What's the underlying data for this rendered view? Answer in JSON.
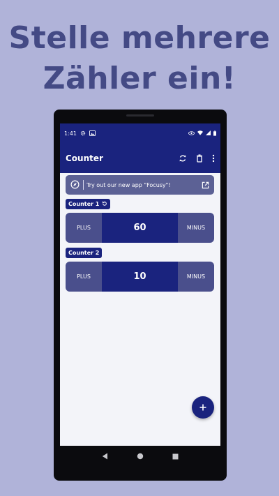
{
  "headline": {
    "line1": "Stelle mehrere",
    "line2": "Zähler ein!"
  },
  "status_bar": {
    "time": "1:41",
    "icons": [
      "gear-icon",
      "photo-icon",
      "eye-icon",
      "wifi-icon",
      "signal-icon",
      "battery-icon"
    ]
  },
  "app_bar": {
    "title": "Counter",
    "actions": [
      "refresh-icon",
      "delete-icon",
      "more-vert-icon"
    ]
  },
  "banner": {
    "text": "Try out our new app \"Focusy\"!",
    "icons": [
      "compass-icon",
      "open-external-icon"
    ]
  },
  "counters": [
    {
      "name": "Counter 1",
      "value": "60",
      "plus_label": "PLUS",
      "minus_label": "MINUS",
      "has_reset_icon": true
    },
    {
      "name": "Counter 2",
      "value": "10",
      "plus_label": "PLUS",
      "minus_label": "MINUS",
      "has_reset_icon": false
    }
  ],
  "fab": {
    "icon": "plus-icon"
  },
  "nav_bar": {
    "icons": [
      "back-icon",
      "home-icon",
      "recents-icon"
    ]
  },
  "colors": {
    "background": "#b0b3d9",
    "headline": "#444a85",
    "primary": "#1a237e",
    "button_side": "#4a4f8c",
    "banner": "#5c6195",
    "screen_bg": "#f3f4f9"
  }
}
